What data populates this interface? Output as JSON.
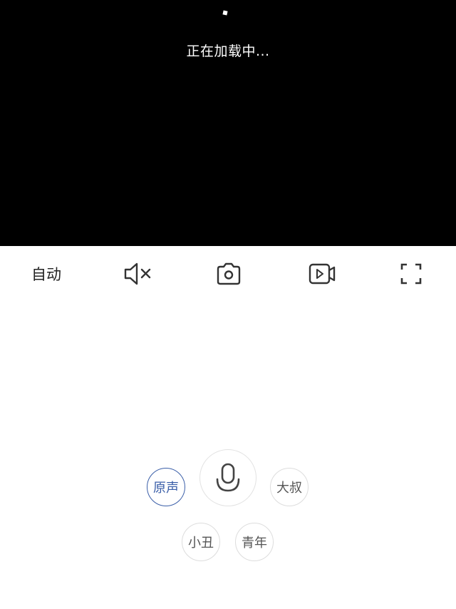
{
  "player": {
    "loading_text": "正在加载中..."
  },
  "toolbar": {
    "quality_label": "自动",
    "mute_icon": "speaker-mute-icon",
    "screenshot_icon": "camera-icon",
    "record_icon": "video-record-icon",
    "fullscreen_icon": "fullscreen-icon"
  },
  "voice": {
    "mic_icon": "microphone-icon",
    "effects": [
      {
        "label": "原声",
        "selected": true
      },
      {
        "label": "大叔",
        "selected": false
      },
      {
        "label": "小丑",
        "selected": false
      },
      {
        "label": "青年",
        "selected": false
      }
    ]
  },
  "colors": {
    "accent": "#3a5ea8",
    "video_bg": "#000000",
    "icon": "#333333"
  }
}
